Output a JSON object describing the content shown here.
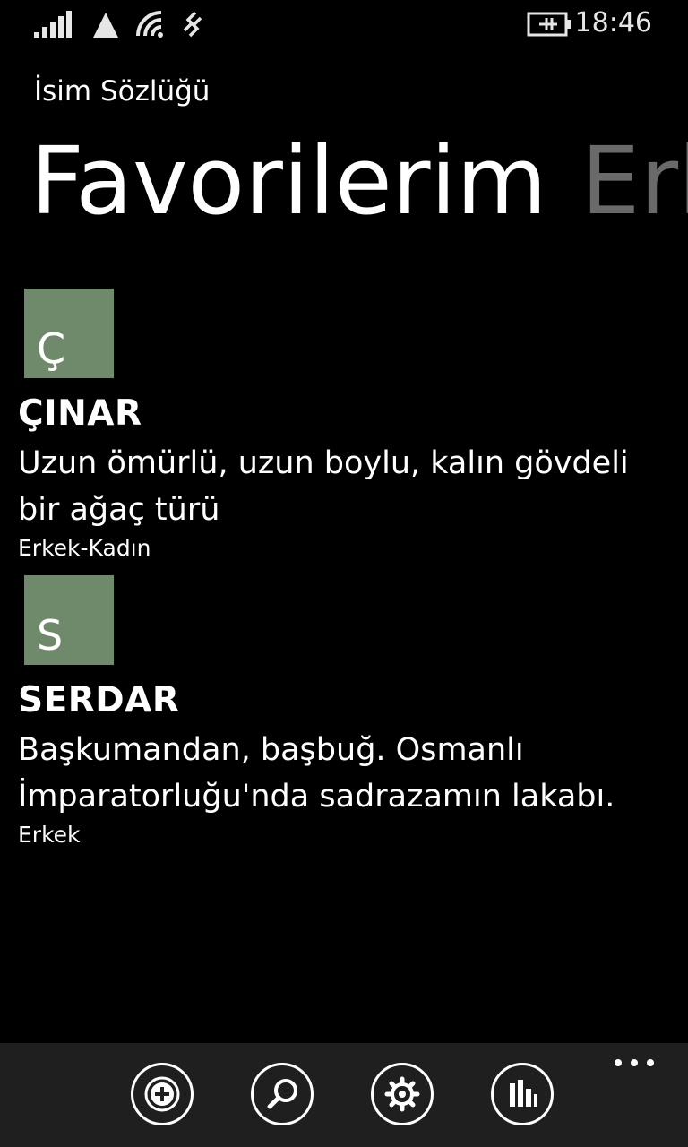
{
  "status_bar": {
    "time": "18:46",
    "icons": [
      "signal-icon",
      "mobile-data-icon",
      "wifi-icon",
      "vibrate-icon",
      "battery-charging-icon"
    ]
  },
  "app": {
    "title": "İsim Sözlüğü"
  },
  "pivot": {
    "active": "Favorilerim",
    "next": "Erkek"
  },
  "favorites": [
    {
      "letter": "Ç",
      "name": "ÇINAR",
      "meaning_line1": "Uzun ömürlü, uzun boylu, kalın gövdeli",
      "meaning_line2": "bir ağaç türü",
      "gender": "Erkek-Kadın"
    },
    {
      "letter": "S",
      "name": "SERDAR",
      "meaning_line1": "Başkumandan, başbuğ. Osmanlı",
      "meaning_line2": "İmparatorluğu'nda sadrazamın lakabı.",
      "gender": "Erkek"
    }
  ],
  "app_bar": {
    "buttons": [
      "add-icon",
      "search-icon",
      "settings-icon",
      "stats-icon"
    ],
    "more": "more-icon"
  },
  "colors": {
    "background": "#000000",
    "tile": "#6f8a6b",
    "pivot_inactive": "#6a6a6a",
    "app_bar": "#1f1f1f"
  }
}
